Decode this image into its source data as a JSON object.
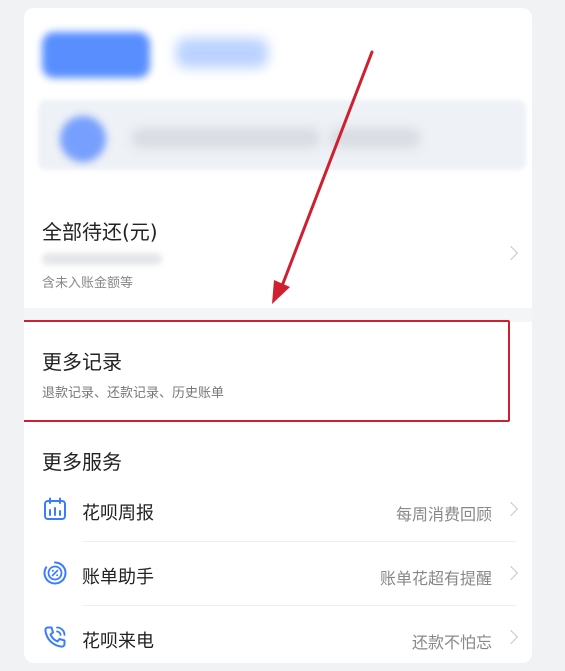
{
  "total": {
    "title": "全部待还(元)",
    "subtitle": "含未入账金额等"
  },
  "records": {
    "title": "更多记录",
    "subtitle": "退款记录、还款记录、历史账单"
  },
  "services": {
    "title": "更多服务",
    "items": [
      {
        "icon": "calendar-icon",
        "label": "花呗周报",
        "hint": "每周消费回顾"
      },
      {
        "icon": "percent-badge-icon",
        "label": "账单助手",
        "hint": "账单花超有提醒"
      },
      {
        "icon": "phone-icon",
        "label": "花呗来电",
        "hint": "还款不怕忘"
      }
    ]
  },
  "colors": {
    "accent": "#3b7bff",
    "highlight": "#d01f2f",
    "arrow": "#d01f2f"
  }
}
